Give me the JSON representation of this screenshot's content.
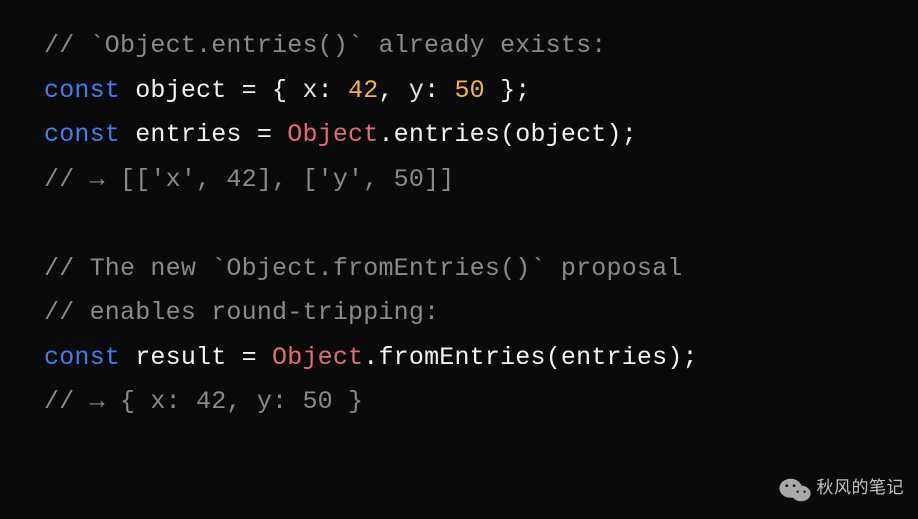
{
  "code": {
    "line1_comment": "// `Object.entries()` already exists:",
    "line2_const": "const",
    "line2_ident": "object",
    "line2_eq": " = ",
    "line2_brace_open": "{ ",
    "line2_key1": "x",
    "line2_colon1": ": ",
    "line2_val1": "42",
    "line2_comma": ", ",
    "line2_key2": "y",
    "line2_colon2": ": ",
    "line2_val2": "50",
    "line2_brace_close": " };",
    "line3_const": "const",
    "line3_ident": "entries",
    "line3_eq": " = ",
    "line3_class": "Object",
    "line3_dot": ".",
    "line3_method": "entries",
    "line3_paren_open": "(",
    "line3_arg": "object",
    "line3_paren_close": ");",
    "line4_comment": "// → [['x', 42], ['y', 50]]",
    "line6_comment": "// The new `Object.fromEntries()` proposal",
    "line7_comment": "// enables round-tripping:",
    "line8_const": "const",
    "line8_ident": "result",
    "line8_eq": " = ",
    "line8_class": "Object",
    "line8_dot": ".",
    "line8_method": "fromEntries",
    "line8_paren_open": "(",
    "line8_arg": "entries",
    "line8_paren_close": ");",
    "line9_comment": "// → { x: 42, y: 50 }"
  },
  "watermark": {
    "text": "秋风的笔记"
  }
}
